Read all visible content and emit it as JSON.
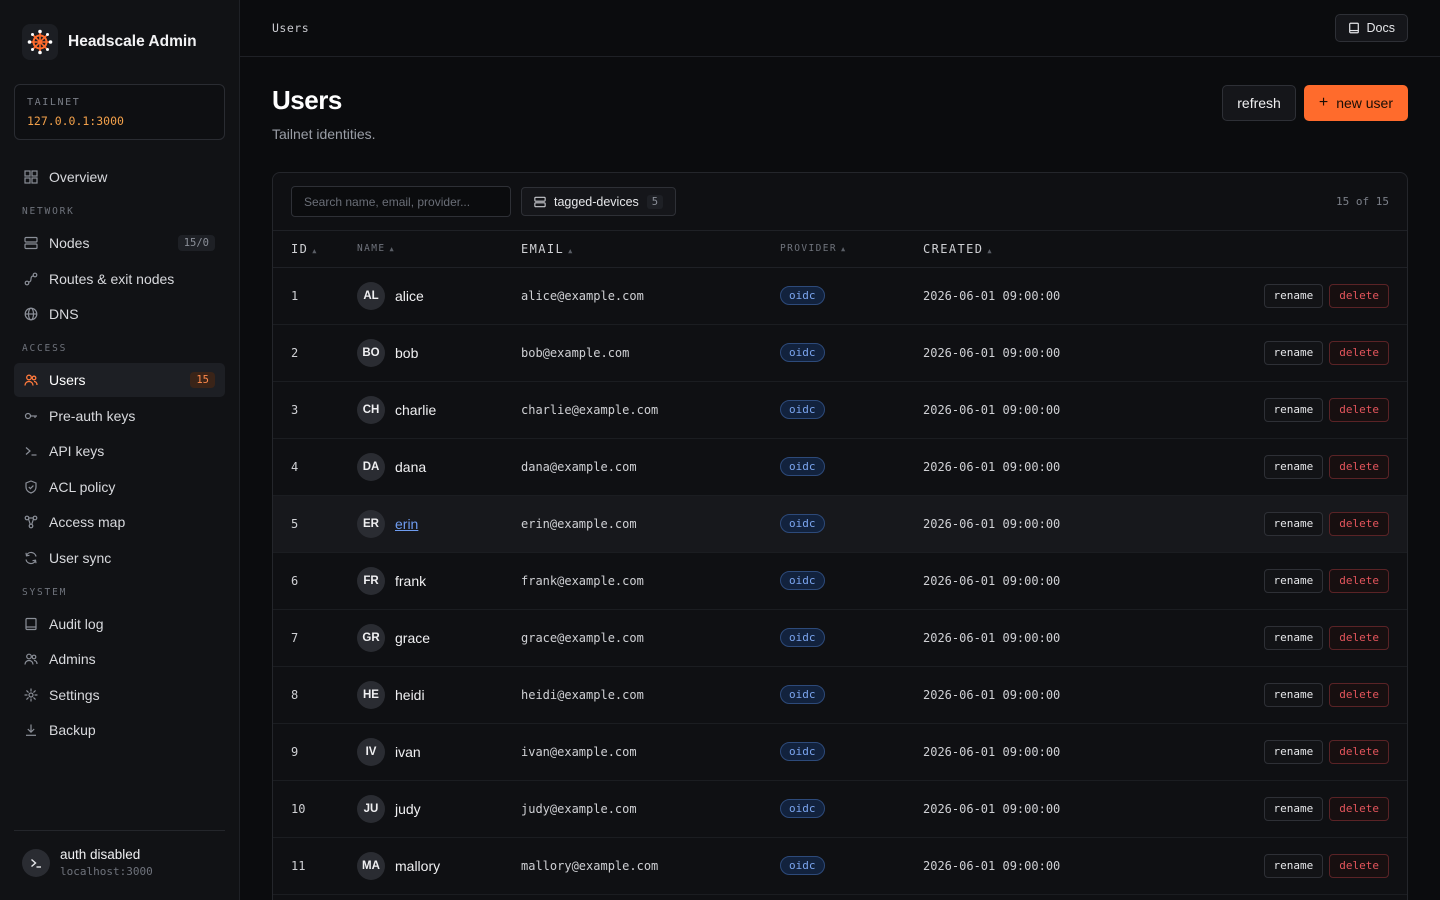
{
  "brand": {
    "title": "Headscale Admin"
  },
  "tailnet": {
    "label": "TAILNET",
    "value": "127.0.0.1:3000"
  },
  "nav": {
    "top": [
      {
        "label": "Overview",
        "icon": "grid-icon"
      }
    ],
    "network_label": "NETWORK",
    "network": [
      {
        "label": "Nodes",
        "icon": "server-icon",
        "count": "15/0"
      },
      {
        "label": "Routes & exit nodes",
        "icon": "route-icon"
      },
      {
        "label": "DNS",
        "icon": "globe-icon"
      }
    ],
    "access_label": "ACCESS",
    "access": [
      {
        "label": "Users",
        "icon": "users-icon",
        "count": "15",
        "active": true
      },
      {
        "label": "Pre-auth keys",
        "icon": "key-icon"
      },
      {
        "label": "API keys",
        "icon": "terminal-icon"
      },
      {
        "label": "ACL policy",
        "icon": "shield-icon"
      },
      {
        "label": "Access map",
        "icon": "network-icon"
      },
      {
        "label": "User sync",
        "icon": "sync-icon"
      }
    ],
    "system_label": "SYSTEM",
    "system": [
      {
        "label": "Audit log",
        "icon": "book-icon"
      },
      {
        "label": "Admins",
        "icon": "admins-icon"
      },
      {
        "label": "Settings",
        "icon": "gear-icon"
      },
      {
        "label": "Backup",
        "icon": "download-icon"
      }
    ]
  },
  "footer": {
    "title": "auth disabled",
    "sub": "localhost:3000"
  },
  "topbar": {
    "breadcrumb": "Users",
    "docs_label": "Docs"
  },
  "page": {
    "title": "Users",
    "subtitle": "Tailnet identities.",
    "refresh_label": "refresh",
    "new_label": "new user"
  },
  "toolbar": {
    "search_placeholder": "Search name, email, provider...",
    "tag_label": "tagged-devices",
    "tag_count": "5",
    "total": "15 of 15"
  },
  "table": {
    "headers": {
      "id": "ID",
      "name": "NAME",
      "email": "EMAIL",
      "provider": "PROVIDER",
      "created": "CREATED"
    },
    "rename_label": "rename",
    "delete_label": "delete",
    "rows": [
      {
        "id": "1",
        "initials": "AL",
        "name": "alice",
        "email": "alice@example.com",
        "provider": "oidc",
        "created": "2026-06-01 09:00:00"
      },
      {
        "id": "2",
        "initials": "BO",
        "name": "bob",
        "email": "bob@example.com",
        "provider": "oidc",
        "created": "2026-06-01 09:00:00"
      },
      {
        "id": "3",
        "initials": "CH",
        "name": "charlie",
        "email": "charlie@example.com",
        "provider": "oidc",
        "created": "2026-06-01 09:00:00"
      },
      {
        "id": "4",
        "initials": "DA",
        "name": "dana",
        "email": "dana@example.com",
        "provider": "oidc",
        "created": "2026-06-01 09:00:00"
      },
      {
        "id": "5",
        "initials": "ER",
        "name": "erin",
        "email": "erin@example.com",
        "provider": "oidc",
        "created": "2026-06-01 09:00:00",
        "hover": true
      },
      {
        "id": "6",
        "initials": "FR",
        "name": "frank",
        "email": "frank@example.com",
        "provider": "oidc",
        "created": "2026-06-01 09:00:00"
      },
      {
        "id": "7",
        "initials": "GR",
        "name": "grace",
        "email": "grace@example.com",
        "provider": "oidc",
        "created": "2026-06-01 09:00:00"
      },
      {
        "id": "8",
        "initials": "HE",
        "name": "heidi",
        "email": "heidi@example.com",
        "provider": "oidc",
        "created": "2026-06-01 09:00:00"
      },
      {
        "id": "9",
        "initials": "IV",
        "name": "ivan",
        "email": "ivan@example.com",
        "provider": "oidc",
        "created": "2026-06-01 09:00:00"
      },
      {
        "id": "10",
        "initials": "JU",
        "name": "judy",
        "email": "judy@example.com",
        "provider": "oidc",
        "created": "2026-06-01 09:00:00"
      },
      {
        "id": "11",
        "initials": "MA",
        "name": "mallory",
        "email": "mallory@example.com",
        "provider": "oidc",
        "created": "2026-06-01 09:00:00"
      }
    ]
  },
  "colors": {
    "accent": "#ff6b2c",
    "danger": "#e4555c",
    "link": "#6f9cf0",
    "tailnet": "#f2a04a"
  }
}
